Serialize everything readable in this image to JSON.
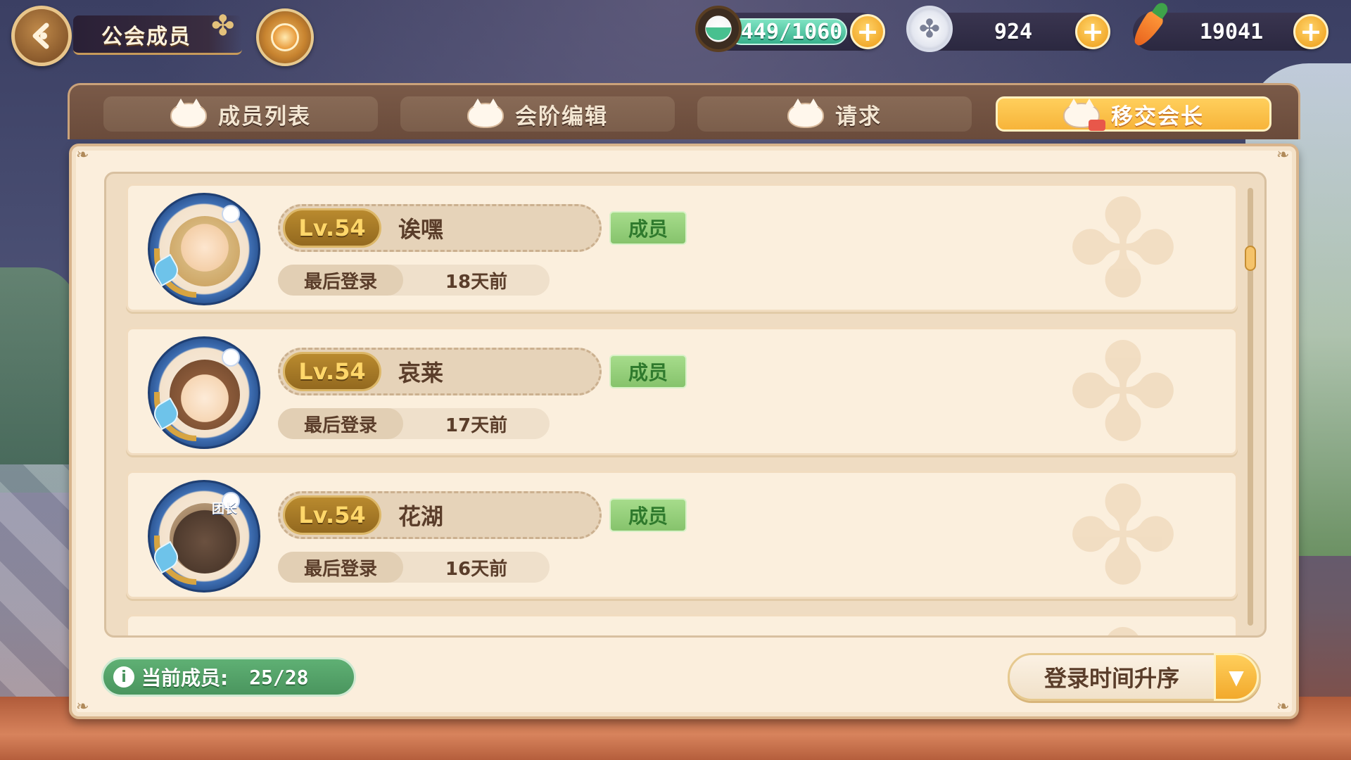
{
  "header": {
    "title": "公会成员",
    "back_icon": "back-arrow-icon",
    "emblem_icon": "guild-emblem-icon"
  },
  "resources": {
    "stamina": {
      "value": "449/1060",
      "icon": "potion-icon"
    },
    "clover": {
      "value": "924",
      "icon": "clover-coin-icon"
    },
    "carrot": {
      "value": "19041",
      "icon": "carrot-icon"
    }
  },
  "tabs": [
    {
      "label": "成员列表",
      "active": false
    },
    {
      "label": "会阶编辑",
      "active": false
    },
    {
      "label": "请求",
      "active": false
    },
    {
      "label": "移交会长",
      "active": true
    }
  ],
  "members": [
    {
      "level": "Lv.54",
      "name": "诶嘿",
      "role": "成员",
      "login_label": "最后登录",
      "login_value": "18天前"
    },
    {
      "level": "Lv.54",
      "name": "哀莱",
      "role": "成员",
      "login_label": "最后登录",
      "login_value": "17天前"
    },
    {
      "level": "Lv.54",
      "name": "花湖",
      "role": "成员",
      "login_label": "最后登录",
      "login_value": "16天前",
      "avatar_tag": "团长"
    }
  ],
  "footer": {
    "member_count_label": "当前成员:",
    "member_count_value": "25/28",
    "sort_label": "登录时间升序"
  },
  "colors": {
    "accent": "#f7b43a",
    "panel": "#fbeedc",
    "role_green": "#86c36c",
    "count_green": "#4a955e",
    "level_gold": "#93691f"
  }
}
